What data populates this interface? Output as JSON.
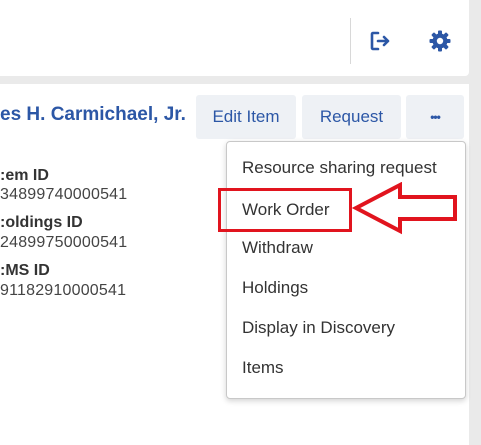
{
  "header": {
    "logout_icon": "logout-icon",
    "settings_icon": "gear-icon",
    "accent_color": "#2c57a6"
  },
  "record": {
    "title": "es H. Carmichael, Jr.",
    "actions": {
      "edit_label": "Edit Item",
      "request_label": "Request",
      "more_label": "•••"
    },
    "fields": [
      {
        "label": "em ID:",
        "value": "34899740000541"
      },
      {
        "label": "oldings ID:",
        "value": "24899750000541"
      },
      {
        "label": "MS ID:",
        "value": "91182910000541"
      }
    ]
  },
  "dropdown": {
    "items": [
      "Resource sharing request",
      "Work Order",
      "Withdraw",
      "Holdings",
      "Display in Discovery",
      "Items"
    ],
    "highlighted_item": "Work Order",
    "annotation_color": "#e1141e"
  }
}
